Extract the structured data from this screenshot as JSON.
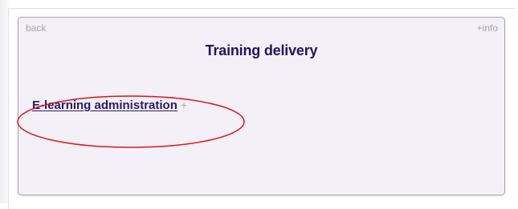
{
  "panel": {
    "back_label": "back",
    "info_label": "+info",
    "title": "Training delivery",
    "items": [
      {
        "label": "E-learning administration",
        "expand_symbol": "+"
      }
    ]
  },
  "annotation": {
    "highlight_color": "#e0141e",
    "highlighted_item": "E-learning administration"
  },
  "colors": {
    "panel_background": "#f3f0f7",
    "title_color": "#25135f",
    "link_color": "#2b1a6b",
    "muted_text": "#a3a3a8"
  }
}
